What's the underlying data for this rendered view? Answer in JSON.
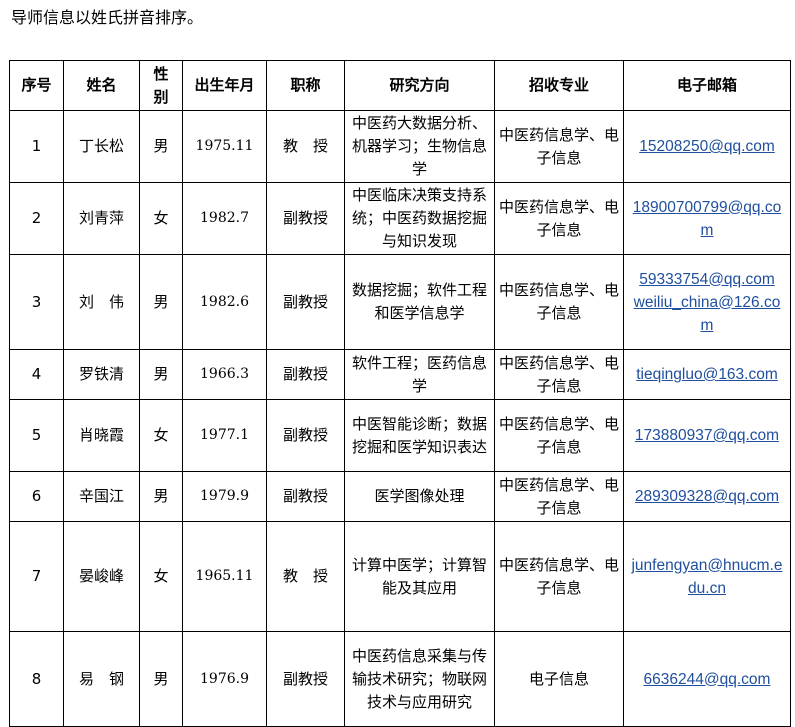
{
  "intro": "导师信息以姓氏拼音排序。",
  "table": {
    "headers": [
      "序号",
      "姓名",
      "性别",
      "出生年月",
      "职称",
      "研究方向",
      "招收专业",
      "电子邮箱"
    ],
    "rows": [
      {
        "no": "1",
        "name": "丁长松",
        "gender": "男",
        "birth": "1975.11",
        "title": "教　授",
        "research": "中医药大数据分析、机器学习；生物信息学",
        "major": "中医药信息学、电子信息",
        "email": "15208250@qq.com"
      },
      {
        "no": "2",
        "name": "刘青萍",
        "gender": "女",
        "birth": "1982.7",
        "title": "副教授",
        "research": "中医临床决策支持系统；中医药数据挖掘与知识发现",
        "major": "中医药信息学、电子信息",
        "email": "18900700799@qq.com"
      },
      {
        "no": "3",
        "name": "刘　伟",
        "gender": "男",
        "birth": "1982.6",
        "title": "副教授",
        "research": "数据挖掘；软件工程和医学信息学",
        "major": "中医药信息学、电子信息",
        "email": "59333754@qq.com",
        "email2": "weiliu_china@126.com"
      },
      {
        "no": "4",
        "name": "罗铁清",
        "gender": "男",
        "birth": "1966.3",
        "title": "副教授",
        "research": "软件工程；医药信息学",
        "major": "中医药信息学、电子信息",
        "email": "tieqingluo@163.com"
      },
      {
        "no": "5",
        "name": "肖晓霞",
        "gender": "女",
        "birth": "1977.1",
        "title": "副教授",
        "research": "中医智能诊断；数据挖掘和医学知识表达",
        "major": "中医药信息学、电子信息",
        "email": "173880937@qq.com"
      },
      {
        "no": "6",
        "name": "辛国江",
        "gender": "男",
        "birth": "1979.9",
        "title": "副教授",
        "research": "医学图像处理",
        "major": "中医药信息学、电子信息",
        "email": "289309328@qq.com"
      },
      {
        "no": "7",
        "name": "晏峻峰",
        "gender": "女",
        "birth": "1965.11",
        "title": "教　授",
        "research": "计算中医学；计算智能及其应用",
        "major": "中医药信息学、电子信息",
        "email": "junfengyan@hnucm.edu.cn"
      },
      {
        "no": "8",
        "name": "易　钢",
        "gender": "男",
        "birth": "1976.9",
        "title": "副教授",
        "research": "中医药信息采集与传输技术研究；物联网技术与应用研究",
        "major": "电子信息",
        "email": "6636244@qq.com"
      }
    ]
  }
}
